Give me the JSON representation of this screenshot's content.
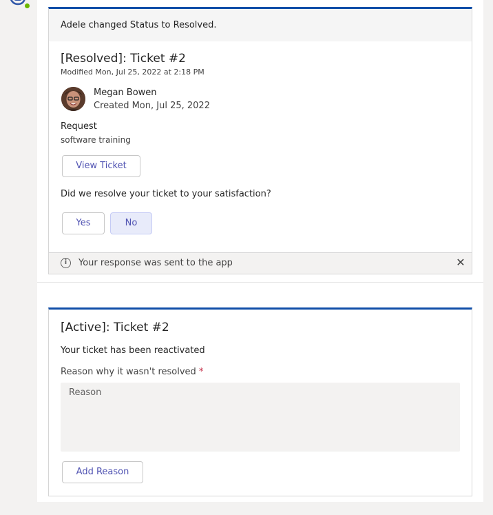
{
  "card1": {
    "banner": "Adele changed Status to Resolved.",
    "title": "[Resolved]: Ticket #2",
    "modified": "Modified Mon, Jul 25, 2022 at 2:18 PM",
    "person": {
      "name": "Megan Bowen",
      "created": "Created Mon, Jul 25, 2022"
    },
    "request_label": "Request",
    "request_value": "software training",
    "view_button": "View Ticket",
    "question": "Did we resolve your ticket to your satisfaction?",
    "yes_button": "Yes",
    "no_button": "No",
    "response": "Your response was sent to the app",
    "accent": "#0f4ea8"
  },
  "card2": {
    "title": "[Active]: Ticket #2",
    "subtitle": "Your ticket has been reactivated",
    "reason_label": "Reason why it wasn't resolved",
    "required_mark": "*",
    "reason_placeholder": "Reason",
    "add_button": "Add Reason"
  },
  "icons": {
    "bot": "bot-icon",
    "status": "available-icon",
    "info": "info-icon",
    "close": "close-icon"
  }
}
